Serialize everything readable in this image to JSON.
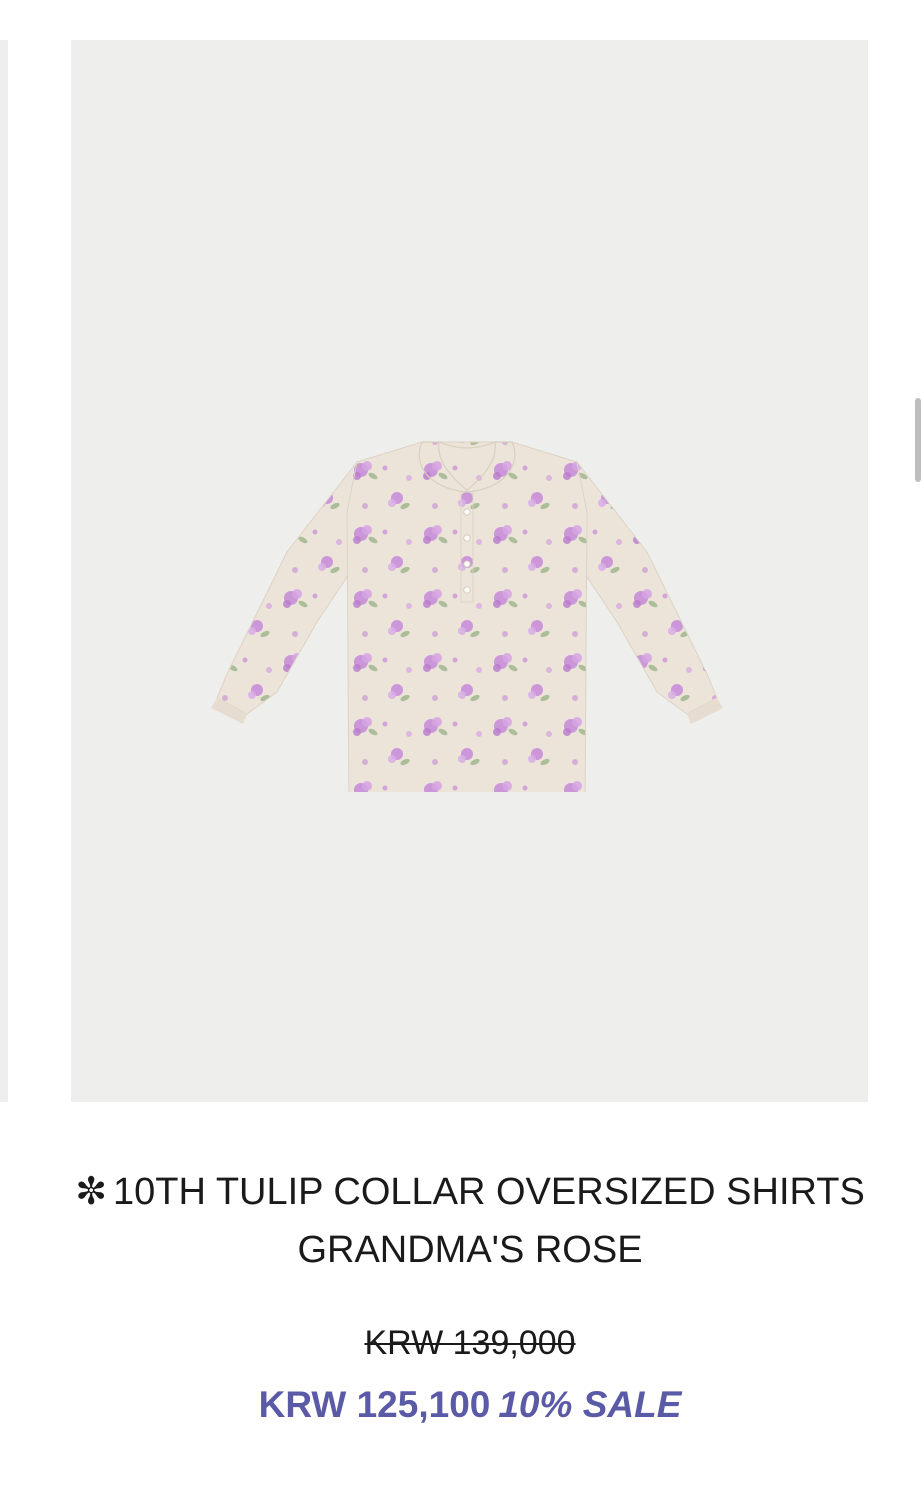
{
  "product": {
    "image_alt": "Floral print long-sleeve collared shirt",
    "title_prefix_icon": "snowflake-icon",
    "title_symbol": "✼",
    "title_line1": "10TH TULIP COLLAR OVERSIZED SHIRTS",
    "title_line2": "GRANDMA'S ROSE",
    "original_price": "KRW 139,000",
    "sale_price": "KRW 125,100",
    "sale_label": "10% SALE"
  },
  "colors": {
    "background": "#ffffff",
    "image_background": "#eeeeed",
    "accent": "#5b5aa6",
    "text": "#1a1a1a",
    "shirt_base": "#ece4d8",
    "flower": "#c68ad8",
    "leaf": "#9bb38a"
  }
}
